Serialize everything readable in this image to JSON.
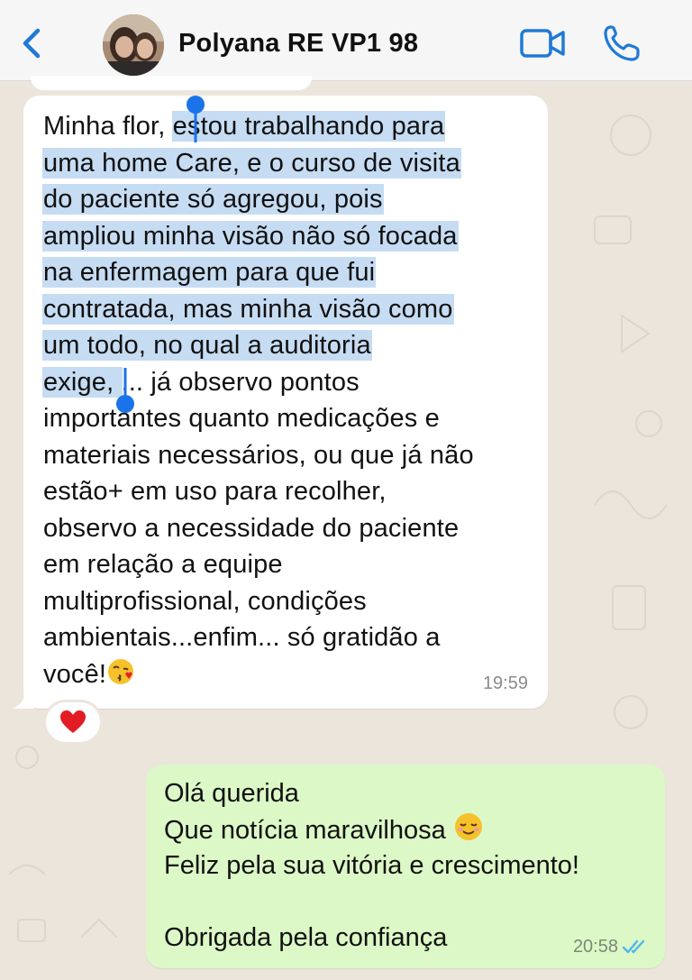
{
  "header": {
    "contact_name": "Polyana RE VP1 98",
    "icons": [
      "back-icon",
      "video-call-icon",
      "phone-call-icon"
    ],
    "accent_color": "#1f7ad6"
  },
  "incoming_message": {
    "lines": [
      {
        "pre": "Minha flor, ",
        "hl": "estou trabalhando para",
        "post": ""
      },
      {
        "pre": "",
        "hl": "uma home Care, e o curso de visita",
        "post": ""
      },
      {
        "pre": "",
        "hl": "do paciente só agregou, pois",
        "post": ""
      },
      {
        "pre": "",
        "hl": "ampliou minha visão não só focada",
        "post": ""
      },
      {
        "pre": "",
        "hl": "na enfermagem para que fui",
        "post": ""
      },
      {
        "pre": "",
        "hl": "contratada, mas minha visão como",
        "post": ""
      },
      {
        "pre": "",
        "hl": "um todo, no qual a auditoria",
        "post": ""
      },
      {
        "pre": "",
        "hl": "exige, ",
        "post": "... já observo pontos"
      },
      {
        "pre": "importantes quanto medicações e",
        "hl": "",
        "post": ""
      },
      {
        "pre": "materiais necessários, ou que já não",
        "hl": "",
        "post": ""
      },
      {
        "pre": "estão+ em uso para recolher,",
        "hl": "",
        "post": ""
      },
      {
        "pre": "observo a necessidade do paciente",
        "hl": "",
        "post": ""
      },
      {
        "pre": "em relação a equipe",
        "hl": "",
        "post": ""
      },
      {
        "pre": "multiprofissional, condições",
        "hl": "",
        "post": ""
      },
      {
        "pre": "ambientais...enfim... só gratidão a",
        "hl": "",
        "post": ""
      },
      {
        "pre": "você!",
        "hl": "",
        "post": ""
      }
    ],
    "time": "19:59",
    "reaction": "heart",
    "selection_color": "#c6dcf3"
  },
  "outgoing_message": {
    "lines": [
      "Olá querida",
      "Que notícia maravilhosa ",
      "Feliz pela sua vitória e crescimento!",
      "",
      "Obrigada pela confiança"
    ],
    "time": "20:58",
    "status": "read",
    "bubble_color": "#dcf8c6"
  }
}
